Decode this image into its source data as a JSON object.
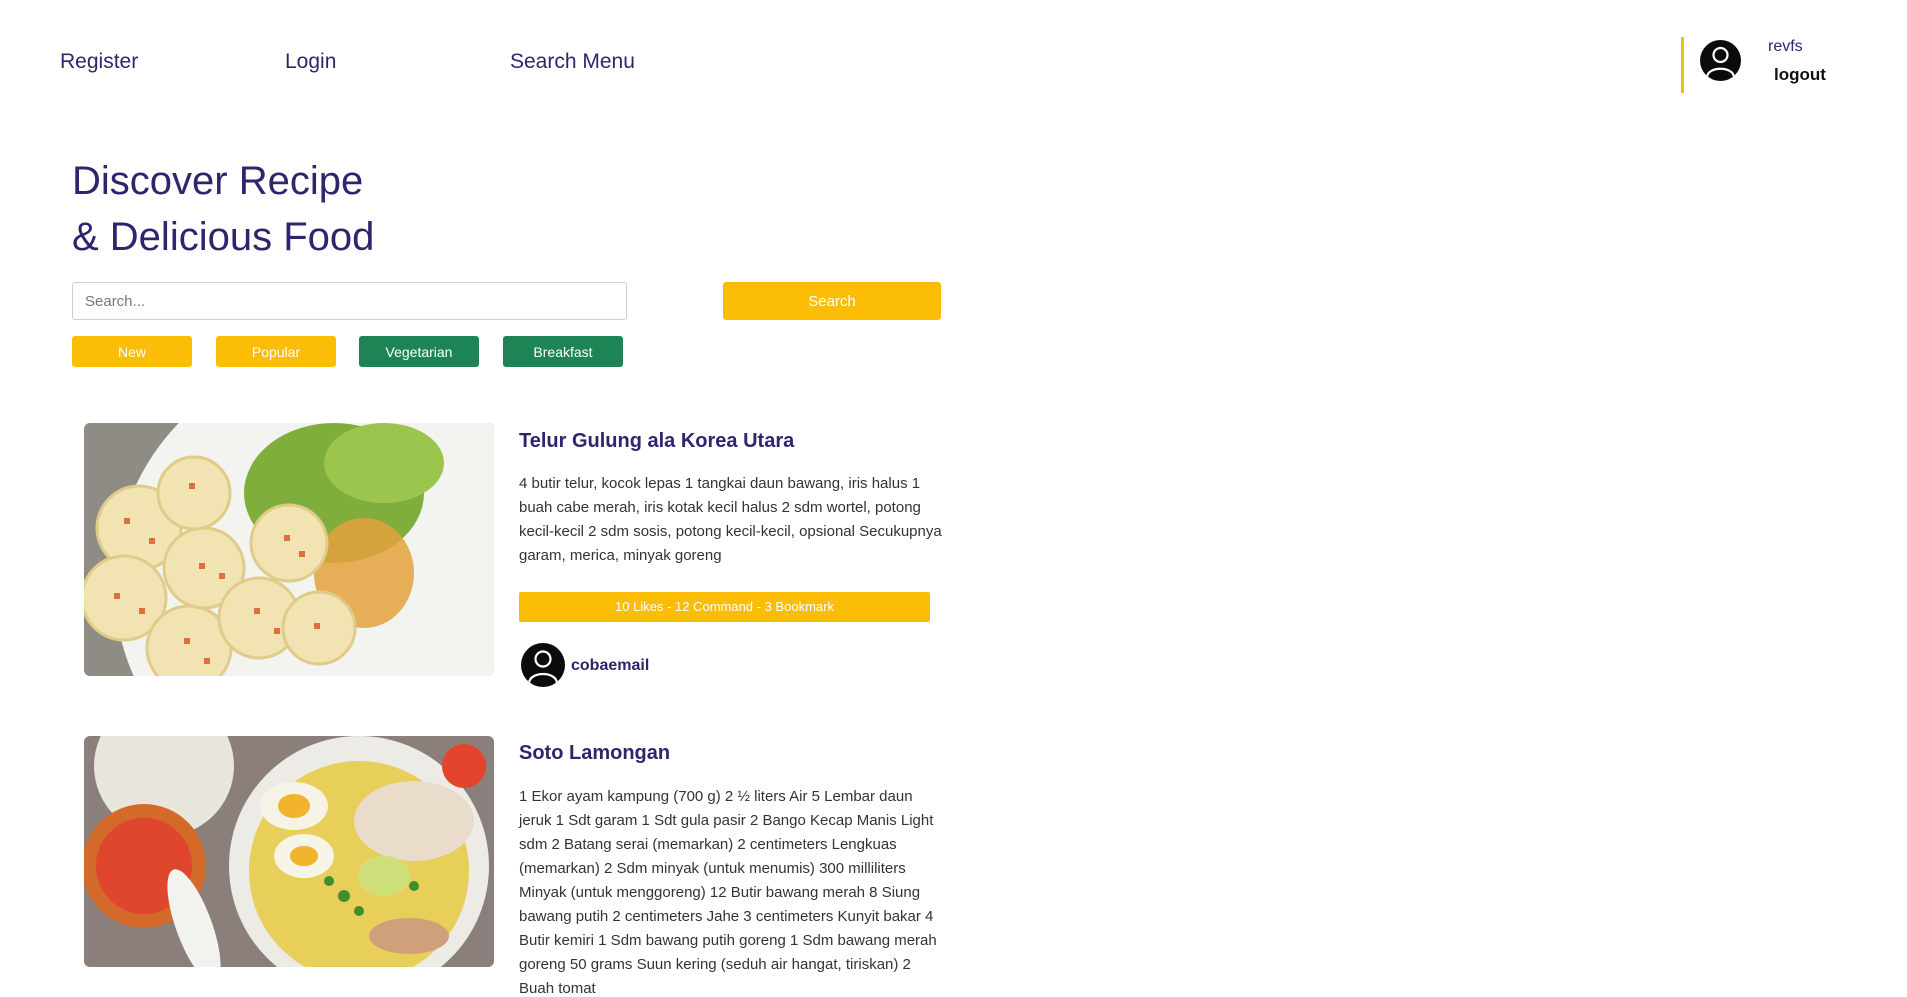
{
  "nav": {
    "register": "Register",
    "login": "Login",
    "search_menu": "Search Menu"
  },
  "profile": {
    "username": "revfs",
    "logout": "logout"
  },
  "hero": {
    "title_line1": "Discover Recipe",
    "title_line2": "& Delicious Food"
  },
  "search": {
    "placeholder": "Search...",
    "button": "Search"
  },
  "categories": [
    {
      "label": "New",
      "color": "#fbbd06"
    },
    {
      "label": "Popular",
      "color": "#fbbd06"
    },
    {
      "label": "Vegetarian",
      "color": "#1d8555"
    },
    {
      "label": "Breakfast",
      "color": "#1d8555"
    }
  ],
  "recipes": [
    {
      "title": "Telur Gulung ala Korea Utara",
      "description": "4 butir telur, kocok lepas 1 tangkai daun bawang, iris halus 1 buah cabe merah, iris kotak kecil halus 2 sdm wortel, potong kecil-kecil 2 sdm sosis, potong kecil-kecil, opsional Secukupnya garam, merica, minyak goreng",
      "stats": "10 Likes - 12 Command - 3 Bookmark",
      "author": "cobaemail"
    },
    {
      "title": "Soto Lamongan",
      "description": "1 Ekor ayam kampung (700 g) 2 ½ liters Air 5 Lembar daun jeruk 1 Sdt garam 1 Sdt gula pasir 2 Bango Kecap Manis Light sdm 2 Batang serai (memarkan) 2 centimeters Lengkuas (memarkan) 2 Sdm minyak (untuk menumis) 300 milliliters Minyak (untuk menggoreng) 12 Butir bawang merah 8 Siung bawang putih 2 centimeters Jahe 3 centimeters Kunyit bakar 4 Butir kemiri 1 Sdm bawang putih goreng 1 Sdm bawang merah goreng 50 grams Suun kering (seduh air hangat, tiriskan) 2 Buah tomat"
    }
  ],
  "colors": {
    "brand_text": "#2e266d",
    "accent_yellow": "#fbbd06",
    "accent_green": "#1d8555"
  }
}
